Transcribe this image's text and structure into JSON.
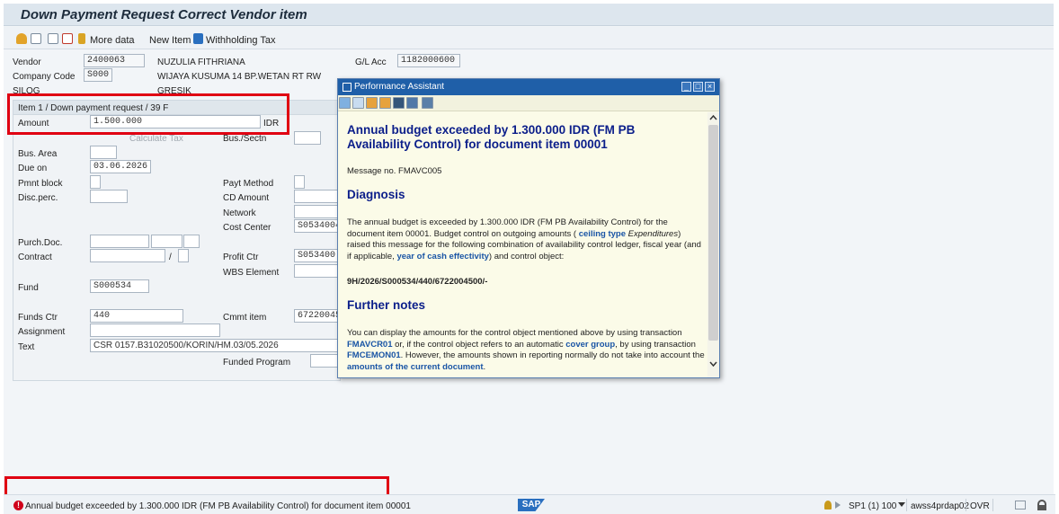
{
  "window": {
    "title": "Down Payment Request Correct Vendor item"
  },
  "toolbar": {
    "icons": [
      "person-icon",
      "refresh-icon",
      "document-icon",
      "copy-icon"
    ],
    "more_data": "More data",
    "new_item": "New Item",
    "withholding_tax": "Withholding Tax"
  },
  "header": {
    "vendor_label": "Vendor",
    "vendor_value": "2400063",
    "vendor_name": "NUZULIA FITHRIANA",
    "company_code_label": "Company Code",
    "company_code_value": "S000",
    "address": "WIJAYA KUSUMA 14 BP.WETAN RT  RW",
    "city1": "SILOG",
    "city2": "GRESIK",
    "gl_acc_label": "G/L Acc",
    "gl_acc_value": "1182000600"
  },
  "item": {
    "header": "Item 1 / Down payment request / 39 F",
    "amount_label": "Amount",
    "amount_value": "1.500.000",
    "currency": "IDR",
    "calculate_tax": "Calculate Tax",
    "bus_area_label": "Bus. Area",
    "bus_sectn_label": "Bus./Sectn",
    "due_on_label": "Due on",
    "due_on_value": "03.06.2026",
    "pmnt_block_label": "Pmnt block",
    "payt_method_label": "Payt Method",
    "disc_perc_label": "Disc.perc.",
    "cd_amount_label": "CD Amount",
    "network_label": "Network",
    "cost_center_label": "Cost Center",
    "cost_center_value": "S0534004",
    "purch_doc_label": "Purch.Doc.",
    "contract_label": "Contract",
    "contract_sep": "/",
    "profit_ctr_label": "Profit Ctr",
    "profit_ctr_value": "S053400",
    "wbs_label": "WBS Element",
    "fund_label": "Fund",
    "fund_value": "S000534",
    "funds_ctr_label": "Funds Ctr",
    "funds_ctr_value": "440",
    "cmmt_item_label": "Cmmt item",
    "cmmt_item_value": "67220045",
    "assignment_label": "Assignment",
    "text_label": "Text",
    "text_value": "CSR 0157.B31020500/KORIN/HM.03/05.2026",
    "funded_program_label": "Funded Program"
  },
  "popup": {
    "title": "Performance Assistant",
    "heading": "Annual budget exceeded by 1.300.000 IDR (FM PB Availability Control) for document item 00001",
    "message_no": "Message no. FMAVC005",
    "diagnosis_title": "Diagnosis",
    "diag_p1": "The annual budget is exceeded by 1.300.000 IDR (FM PB Availability Control) for the document item 00001. Budget control on outgoing amounts (",
    "diag_link1": "ceiling type",
    "diag_italic": "Expenditures",
    "diag_p2": ") raised this message for the following combination of availability control ledger, fiscal year (and if applicable,",
    "diag_link2": "year of cash effectivity",
    "diag_p3": ") and control object:",
    "control_object": "9H/2026/S000534/440/6722004500/-",
    "further_title": "Further notes",
    "fn_p1": "You can display the amounts for the control object mentioned above by using transaction",
    "fn_link1": "FMAVCR01",
    "fn_p2": "or, if the control object refers to an automatic",
    "fn_link2": "cover group",
    "fn_p3": ", by using transaction",
    "fn_link3": "FMCEMON01",
    "fn_p4": ". However, the amounts shown in reporting normally do not take into account the",
    "fn_link4": "amounts of the current document",
    "fn_p5": "."
  },
  "status": {
    "message": "Annual budget exceeded by 1.300.000 IDR (FM PB Availability Control) for document item 00001",
    "logo": "SAP",
    "system": "SP1 (1) 100",
    "server": "awss4prdap02",
    "mode": "OVR"
  },
  "colors": {
    "highlight": "#e00012",
    "popup_heading": "#0b1e8a",
    "link": "#1a55a5"
  }
}
